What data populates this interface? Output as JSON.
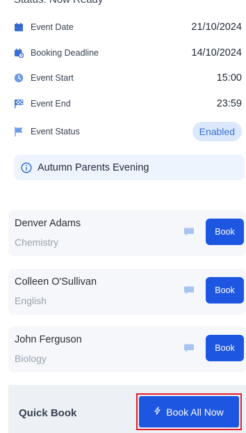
{
  "header": {
    "cut_text": "Status: Now Ready"
  },
  "details": [
    {
      "key": "event_date",
      "icon": "calendar-icon",
      "label": "Event Date",
      "value": "21/10/2024"
    },
    {
      "key": "booking_deadline",
      "icon": "calendar-clock-icon",
      "label": "Booking Deadline",
      "value": "14/10/2024"
    },
    {
      "key": "event_start",
      "icon": "clock-icon",
      "label": "Event Start",
      "value": "15:00"
    },
    {
      "key": "event_end",
      "icon": "checkered-flag-icon",
      "label": "Event End",
      "value": "23:59"
    },
    {
      "key": "event_status",
      "icon": "flag-icon",
      "label": "Event Status",
      "value": "Enabled"
    }
  ],
  "event_info": {
    "icon": "info-icon",
    "title": "Autumn Parents Evening"
  },
  "teachers": [
    {
      "name": "Denver Adams",
      "subject": "Chemistry",
      "book_label": "Book"
    },
    {
      "name": "Colleen O'Sullivan",
      "subject": "English",
      "book_label": "Book"
    },
    {
      "name": "John Ferguson",
      "subject": "Biology",
      "book_label": "Book"
    }
  ],
  "quick_book": {
    "title": "Quick Book",
    "button_label": "Book All Now",
    "button_icon": "lightning-icon"
  },
  "colors": {
    "accent": "#1d56e0",
    "highlight_border": "#e21d2c",
    "icon_blue": "#3b6fd4",
    "badge_bg": "#dbe8fb"
  }
}
